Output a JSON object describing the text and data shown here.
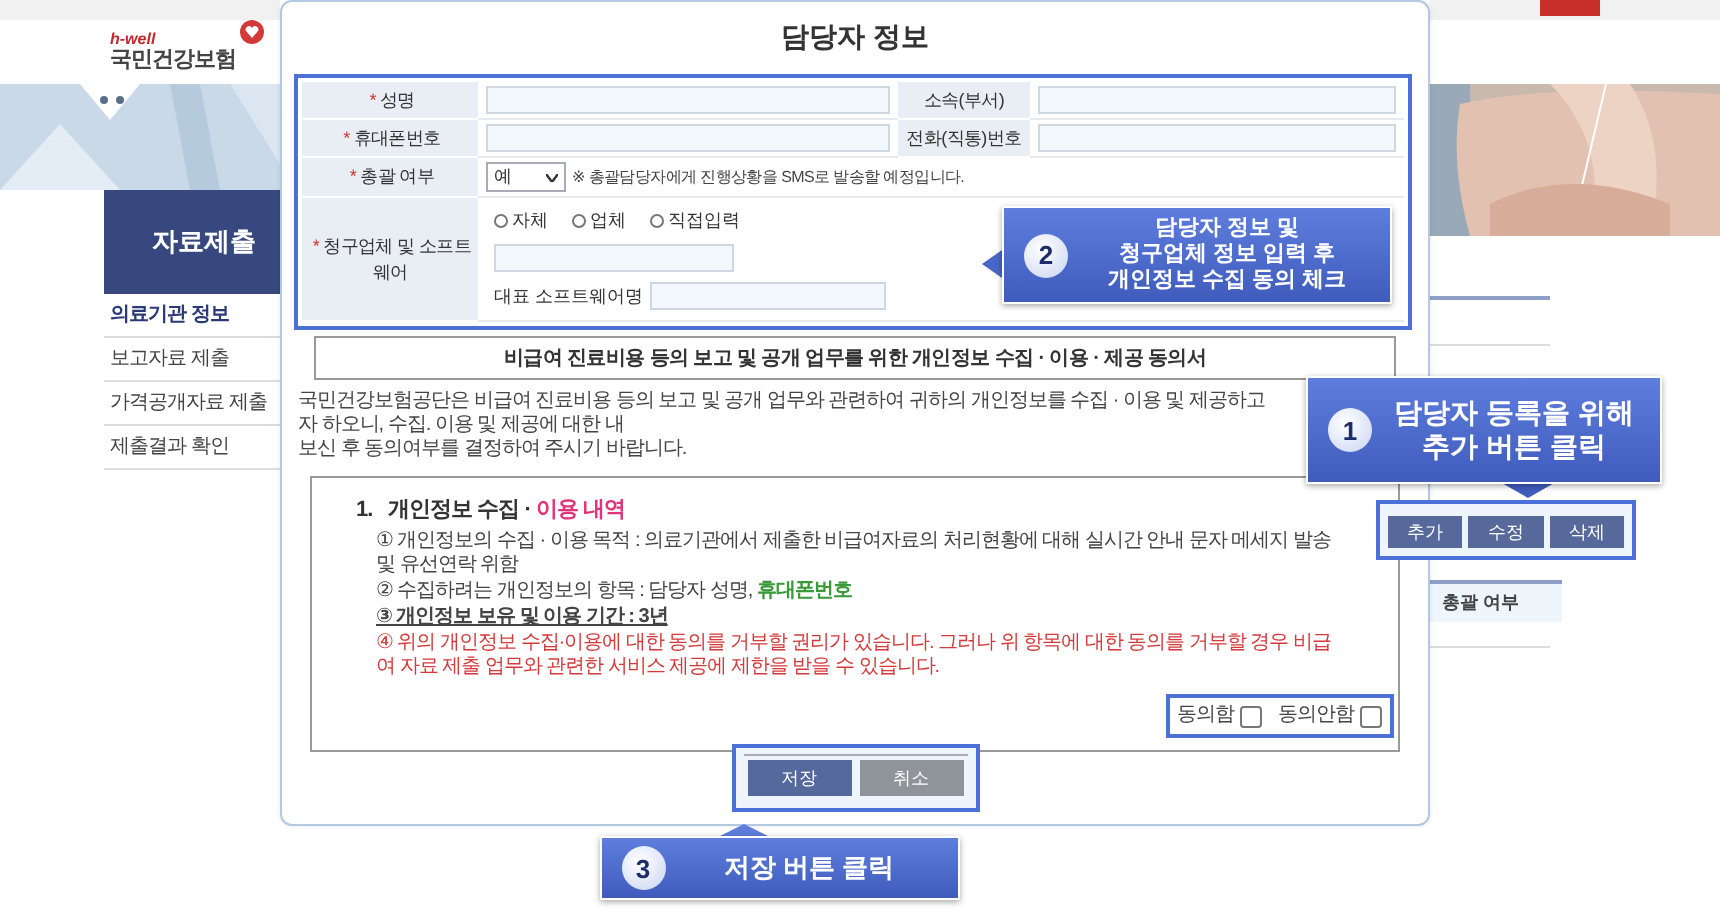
{
  "header": {
    "logo_tagline": "h-well",
    "logo_name": "국민건강보험"
  },
  "sidebar": {
    "title": "자료제출",
    "items": [
      {
        "label": "의료기관 정보",
        "selected": true
      },
      {
        "label": "보고자료 제출",
        "selected": false
      },
      {
        "label": "가격공개자료 제출",
        "selected": false
      },
      {
        "label": "제출결과 확인",
        "selected": false
      }
    ]
  },
  "modal": {
    "title": "담당자 정보",
    "form": {
      "fields": [
        {
          "mark": "*",
          "label": "성명"
        },
        {
          "label": "소속(부서)"
        },
        {
          "mark": "*",
          "label": "휴대폰번호"
        },
        {
          "label": "전화(직통)번호"
        }
      ],
      "summary": {
        "mark": "*",
        "label": "총괄 여부",
        "value": "예",
        "note": "※ 총괄담당자에게 진행상황을 SMS로 발송할 예정입니다."
      },
      "vendor": {
        "mark": "*",
        "label": "청구업체 및 소프트웨어",
        "options": [
          {
            "label": "자체",
            "selected": false
          },
          {
            "label": "업체",
            "selected": false
          },
          {
            "label": "직접입력",
            "selected": false
          }
        ],
        "software_label": "대표 소프트웨어명"
      }
    },
    "consent": {
      "title": "비급여 진료비용 등의 보고 및 공개 업무를 위한 개인정보 수집 · 이용 · 제공 동의서",
      "intro": [
        "국민건강보험공단은 비급여 진료비용 등의 보고 및 공개 업무와 관련하여 귀하의 개인정보를 수집 · 이용 및 제공하고자 하오니, 수집. 이용 및 제공에 대한 내",
        "보신 후 동의여부를 결정하여 주시기 바랍니다."
      ],
      "heading": {
        "number": "1.",
        "text": "개인정보 수집 ·",
        "highlight": "이용 내역"
      },
      "items": [
        {
          "kind": "plain",
          "text": "① 개인정보의 수집 · 이용 목적 : 의료기관에서 제출한 비급여자료의 처리현황에 대해 실시간 안내 문자 메세지 발송 및 유선연락 위함"
        },
        {
          "kind": "highlight",
          "text": "② 수집하려는 개인정보의 항목 : 담당자 성명,",
          "highlight": "휴대폰번호"
        },
        {
          "kind": "underline",
          "text": "③ 개인정보 보유 및 이용 기간 : 3년"
        },
        {
          "kind": "warning",
          "text": "④ 위의 개인정보 수집·이용에 대한 동의를 거부할 권리가 있습니다. 그러나 위 항목에 대한 동의를 거부할 경우 비급여 자료 제출 업무와 관련한 서비스 제공에 제한을 받을 수 있습니다."
        }
      ],
      "agree": [
        {
          "label": "동의함",
          "checked": false
        },
        {
          "label": "동의안함",
          "checked": false
        }
      ]
    },
    "buttons": [
      {
        "label": "저장",
        "kind": "primary"
      },
      {
        "label": "취소",
        "kind": "secondary"
      }
    ]
  },
  "right_panel": {
    "buttons": [
      "추가",
      "수정",
      "삭제"
    ],
    "column_header": "총괄 여부"
  },
  "callouts": [
    {
      "number": "1",
      "lines": [
        "담당자 등록을 위해",
        "추가 버튼 클릭"
      ]
    },
    {
      "number": "2",
      "lines": [
        "담당자 정보 및",
        "청구업체 정보 입력 후",
        "개인정보 수집 동의 체크"
      ]
    },
    {
      "number": "3",
      "lines": [
        "저장 버튼 클릭"
      ]
    }
  ]
}
